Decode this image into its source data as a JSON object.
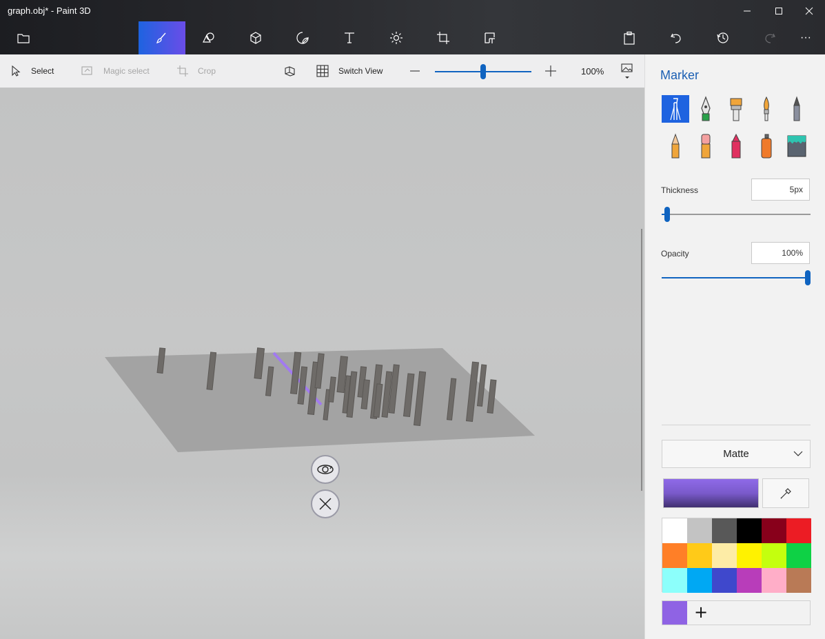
{
  "window": {
    "title": "graph.obj* - Paint 3D",
    "minimize_icon": "minimize-icon",
    "maximize_icon": "maximize-icon",
    "close_icon": "close-icon"
  },
  "toolbar": {
    "tools": [
      {
        "name": "open-menu",
        "icon": "folder-icon",
        "active": false
      },
      {
        "name": "brushes",
        "icon": "brush-icon",
        "active": true
      },
      {
        "name": "2d-shapes",
        "icon": "2d-shapes-icon",
        "active": false
      },
      {
        "name": "3d-shapes",
        "icon": "3d-cube-icon",
        "active": false
      },
      {
        "name": "stickers",
        "icon": "sticker-icon",
        "active": false
      },
      {
        "name": "text",
        "icon": "text-icon",
        "active": false
      },
      {
        "name": "effects",
        "icon": "effects-sun-icon",
        "active": false
      },
      {
        "name": "canvas",
        "icon": "canvas-crop-icon",
        "active": false
      },
      {
        "name": "remix3d",
        "icon": "remix3d-icon",
        "active": false
      }
    ],
    "right": [
      "paste-icon",
      "undo-icon",
      "history-icon",
      "redo-icon",
      "more-icon"
    ],
    "more_label": "···"
  },
  "subbar": {
    "select": "Select",
    "magic_select": "Magic select",
    "crop": "Crop",
    "switch_view": "Switch View",
    "zoom_percent": "100%",
    "zoom_level": 0.5
  },
  "panel": {
    "title": "Marker",
    "brushes": [
      "marker",
      "calligraphy-pen",
      "oil-brush",
      "watercolor",
      "pixel-pen",
      "pencil",
      "eraser",
      "crayon",
      "spray-can",
      "fill"
    ],
    "thickness_label": "Thickness",
    "thickness_value": "5px",
    "thickness_level": 0.02,
    "opacity_label": "Opacity",
    "opacity_value": "100%",
    "opacity_level": 1.0,
    "finish": "Matte",
    "current_color": "#8f6ae8",
    "palette": [
      "#ffffff",
      "#c3c3c3",
      "#585858",
      "#000000",
      "#88001b",
      "#ec1c24",
      "#ff7f27",
      "#ffca18",
      "#fdeca6",
      "#fff200",
      "#c4ff0e",
      "#0ed145",
      "#8cfffb",
      "#00a8f3",
      "#3f48cc",
      "#b83dba",
      "#ffaec8",
      "#b97a56"
    ],
    "custom_color": "#8f63e4",
    "add_color": "+"
  },
  "accent": "#1e63e0"
}
